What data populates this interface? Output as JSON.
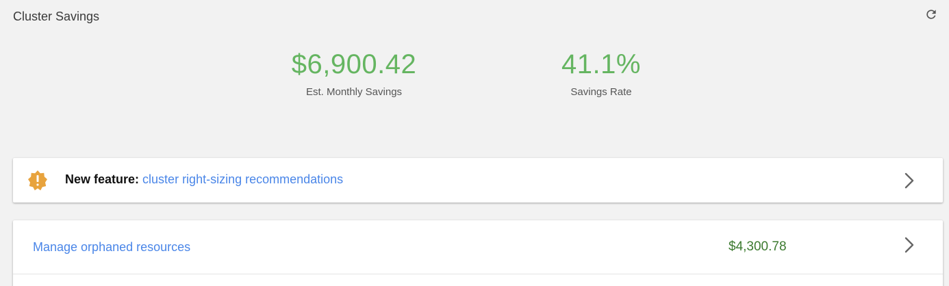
{
  "header": {
    "title": "Cluster Savings",
    "refresh_icon": "refresh-icon"
  },
  "stats": [
    {
      "value": "$6,900.42",
      "label": "Est. Monthly Savings"
    },
    {
      "value": "41.1%",
      "label": "Savings Rate"
    }
  ],
  "feature_banner": {
    "icon": "warning-badge-icon",
    "prefix": "New feature:",
    "link_text": "cluster right-sizing recommendations"
  },
  "orphaned": {
    "link_text": "Manage orphaned resources",
    "amount": "$4,300.78"
  },
  "colors": {
    "accent_green": "#65b561",
    "amount_green": "#3c7a2f",
    "link_blue": "#4a86e8",
    "warning_orange": "#e8a33d"
  }
}
